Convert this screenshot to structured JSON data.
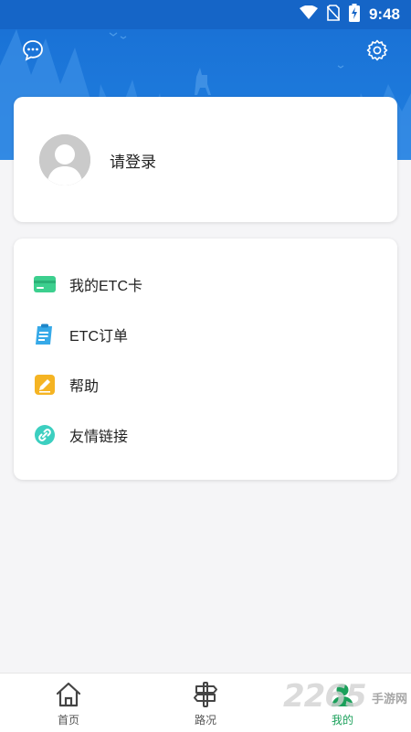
{
  "status_bar": {
    "time": "9:48",
    "icons": [
      "wifi-icon",
      "no-sim-icon",
      "battery-charging-icon"
    ]
  },
  "header": {
    "left_icon": "chat-bubble-icon",
    "right_icon": "gear-icon"
  },
  "profile": {
    "login_label": "请登录",
    "avatar_icon": "default-avatar-icon"
  },
  "menu": {
    "items": [
      {
        "label": "我的ETC卡",
        "icon": "card-icon",
        "color": "#3ccf8e"
      },
      {
        "label": "ETC订单",
        "icon": "clipboard-icon",
        "color": "#36a9e8"
      },
      {
        "label": "帮助",
        "icon": "pencil-icon",
        "color": "#f5b423"
      },
      {
        "label": "友情链接",
        "icon": "link-icon",
        "color": "#3ccfc0"
      }
    ]
  },
  "bottom_nav": {
    "items": [
      {
        "label": "首页",
        "icon": "home-icon",
        "active": false
      },
      {
        "label": "路况",
        "icon": "signpost-icon",
        "active": false
      },
      {
        "label": "我的",
        "icon": "user-icon",
        "active": true
      }
    ]
  },
  "watermark": {
    "main": "2265",
    "sub": "手游网"
  },
  "colors": {
    "header_blue": "#1f7fe0",
    "status_blue": "#1565c7",
    "active_green": "#1aa05a"
  }
}
